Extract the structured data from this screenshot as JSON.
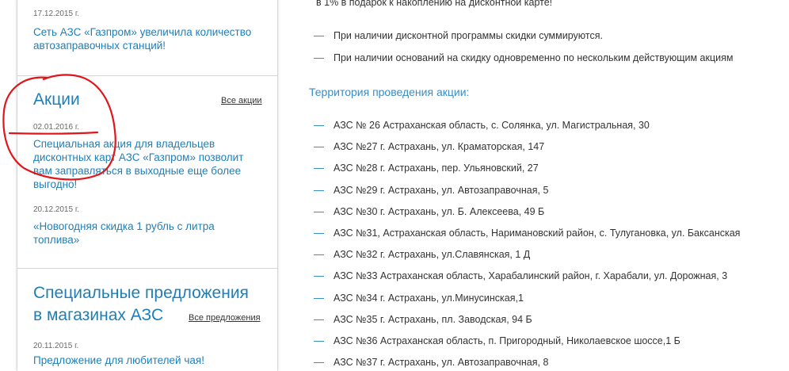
{
  "sidebar": {
    "top_news": {
      "date": "17.12.2015 г.",
      "link": "Сеть АЗС «Газпром» увеличила количество\nавтозаправочных станций!"
    },
    "promos": {
      "title": "Акции",
      "all_link": "Все акции",
      "items": [
        {
          "date": "02.01.2016 г.",
          "link": "Специальная акция для владельцев\nдисконтных карт АЗС «Газпром» позволит\nвам заправляться в выходные еще более\nвыгодно!"
        },
        {
          "date": "20.12.2015 г.",
          "link": "«Новогодняя скидка 1 рубль с литра\nтоплива»"
        }
      ]
    },
    "offers": {
      "title": "Специальные предложения\nв магазинах АЗС",
      "all_link": "Все предложения",
      "items": [
        {
          "date": "20.11.2015 г.",
          "link": "Предложение для любителей чая!"
        }
      ]
    }
  },
  "content": {
    "top_partial": "в  1% в подарок к накоплению на дисконтной карте!",
    "notes": [
      "При наличии дисконтной программы скидки суммируются.",
      "При наличии оснований на скидку одновременно по нескольким действующим акциям"
    ],
    "territory_heading": "Территория проведения акции:",
    "stations": [
      "АЗС № 26 Астраханская область, с. Солянка, ул. Магистральная, 30",
      "АЗС №27 г. Астрахань, ул. Краматорская, 147",
      "АЗС №28 г. Астрахань, пер. Ульяновский, 27",
      "АЗС №29 г. Астрахань, ул. Автозаправочная, 5",
      "АЗС №30 г. Астрахань, ул. Б. Алексеева, 49 Б",
      "АЗС №31, Астраханская область, Наримановский район, с. Тулугановка, ул. Баксанская",
      "АЗС №32 г. Астрахань, ул.Славянская, 1 Д",
      "АЗС №33 Астраханская область, Харабалинский район, г. Харабали, ул. Дорожная, 3",
      "АЗС №34 г. Астрахань, ул.Минусинская,1",
      "АЗС №35 г. Астрахань, пл. Заводская, 94 Б",
      "АЗС №36 Астраханская область, п. Пригородный, Николаевское шоссе,1 Б",
      "АЗС №37 г. Астрахань, ул. Автозаправочная, 8"
    ],
    "dash": "—"
  },
  "colors": {
    "link": "#1e7fb8",
    "heading": "#3b8cc4",
    "annotation": "#e0161b"
  }
}
